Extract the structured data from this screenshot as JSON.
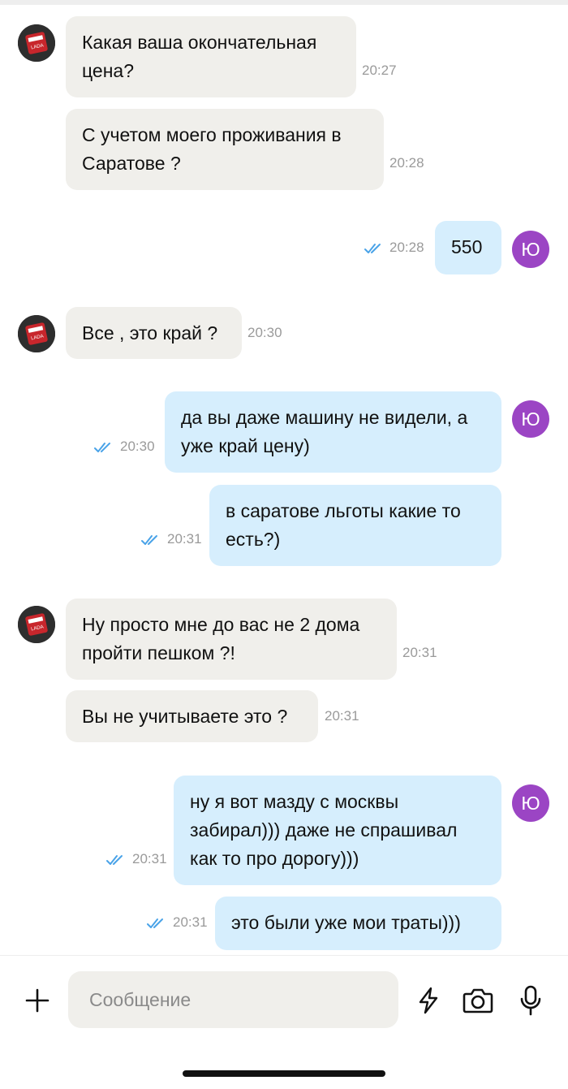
{
  "colors": {
    "incoming_bubble": "#f0efeb",
    "outgoing_bubble": "#d6eefd",
    "my_avatar": "#9b45c4",
    "read_checks": "#4aa3e8"
  },
  "me": {
    "avatar_letter": "Ю"
  },
  "seller": {
    "avatar_icon": "lada-logo-icon",
    "avatar_text": "LADA"
  },
  "messages": [
    {
      "dir": "in",
      "lines": [
        "Какая ваша окончательная",
        "цена?"
      ],
      "time": "20:27"
    },
    {
      "dir": "in",
      "lines": [
        "С учетом моего проживания в",
        "Саратове ?"
      ],
      "time": "20:28"
    },
    {
      "dir": "out",
      "lines": [
        "550"
      ],
      "time": "20:28"
    },
    {
      "dir": "in",
      "lines": [
        "Все , это край ?"
      ],
      "time": "20:30"
    },
    {
      "dir": "out",
      "lines": [
        "да вы даже машину не видели, а",
        "уже край цену)"
      ],
      "time": "20:30"
    },
    {
      "dir": "out",
      "lines": [
        "в саратове льготы какие то",
        "есть?)"
      ],
      "time": "20:31"
    },
    {
      "dir": "in",
      "lines": [
        "Ну просто мне до вас не 2 дома",
        "пройти пешком ?!"
      ],
      "time": "20:31"
    },
    {
      "dir": "in",
      "lines": [
        "Вы не учитываете это ?"
      ],
      "time": "20:31"
    },
    {
      "dir": "out",
      "lines": [
        "ну я вот мазду с москвы",
        "забирал))) даже не спрашивал",
        "как то про дорогу)))"
      ],
      "time": "20:31"
    },
    {
      "dir": "out",
      "lines": [
        "это были уже мои траты)))"
      ],
      "time": "20:31"
    }
  ],
  "composer": {
    "placeholder": "Сообщение",
    "add_icon": "plus-icon",
    "quick_icon": "lightning-icon",
    "camera_icon": "camera-icon",
    "mic_icon": "microphone-icon"
  }
}
